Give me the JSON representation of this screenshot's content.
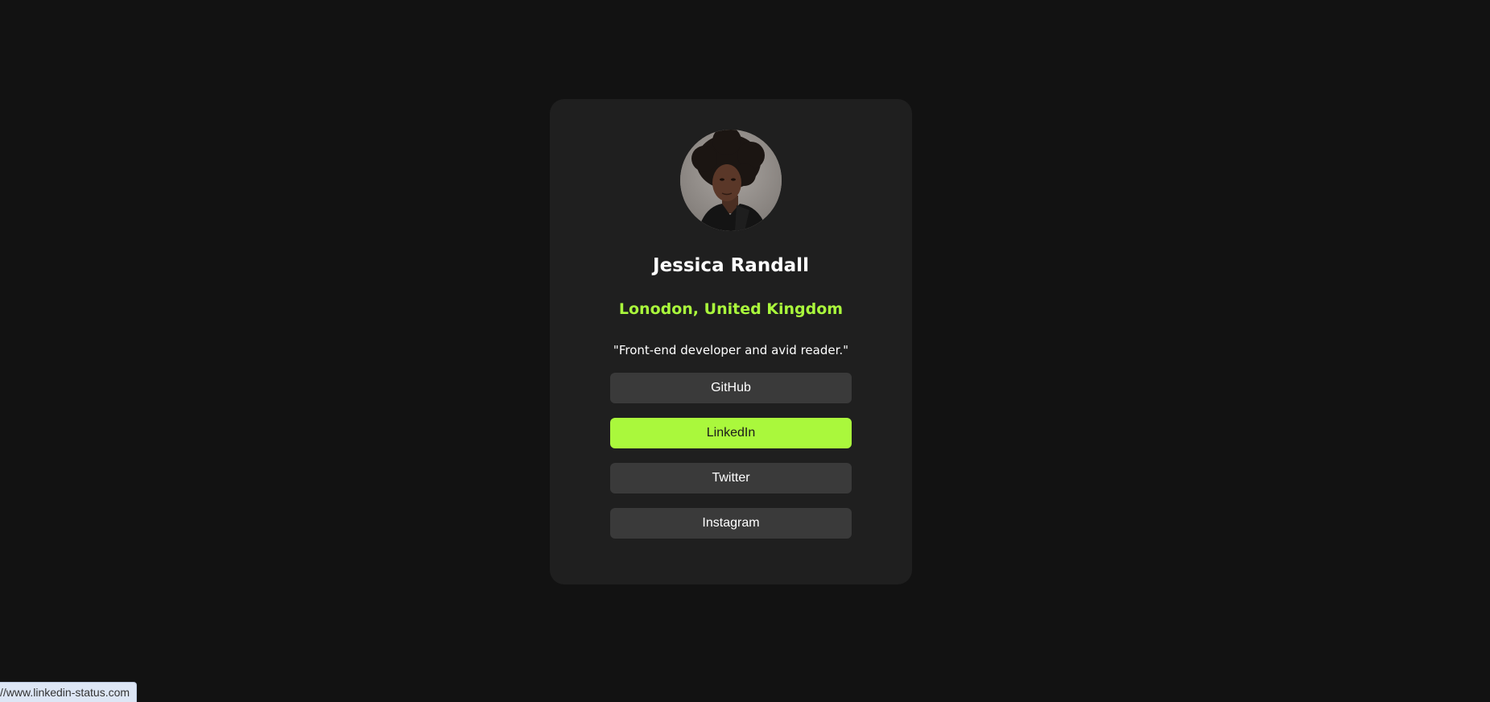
{
  "profile": {
    "name": "Jessica Randall",
    "location": "Lonodon, United Kingdom",
    "bio": "\"Front-end developer and avid reader.\""
  },
  "links": [
    {
      "label": "GitHub",
      "active": false
    },
    {
      "label": "LinkedIn",
      "active": true
    },
    {
      "label": "Twitter",
      "active": false
    },
    {
      "label": "Instagram",
      "active": false
    }
  ],
  "status_bar": {
    "url": "//www.linkedin-status.com"
  },
  "colors": {
    "page_background": "#121212",
    "card_background": "#1f1f1f",
    "accent": "#aaf83c",
    "button_background": "#3a3a3a"
  }
}
